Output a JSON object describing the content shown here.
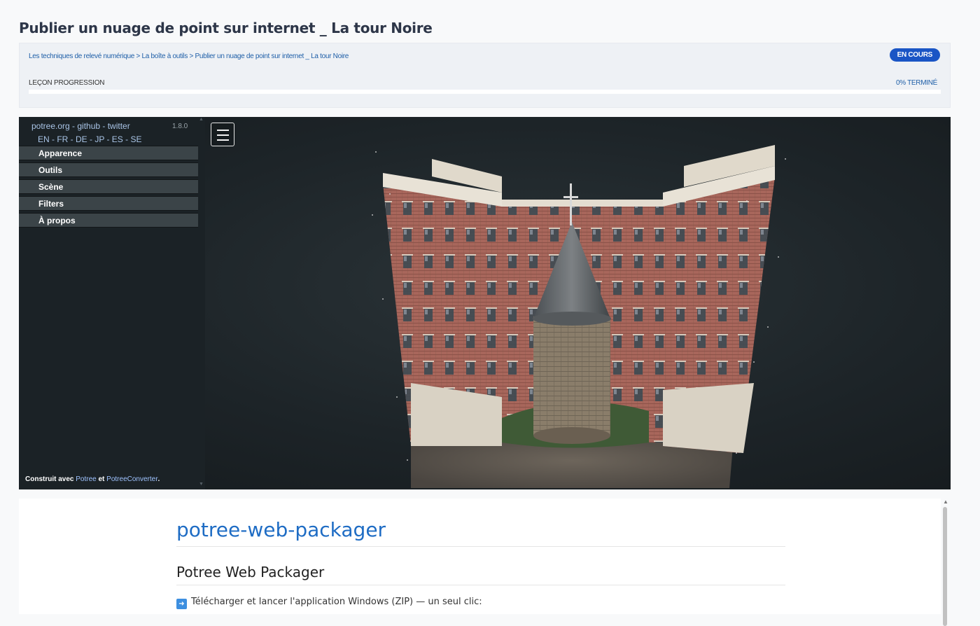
{
  "page": {
    "title": "Publier un nuage de point sur internet _ La tour Noire"
  },
  "lesson": {
    "breadcrumb": [
      "Les techniques de relevé numérique",
      "La boîte à outils",
      "Publier un nuage de point sur internet _ La tour Noire"
    ],
    "breadcrumb_separator": " > ",
    "status": "EN COURS",
    "progress_label": "LEÇON PROGRESSION",
    "progress_text": "0% TERMINÉ",
    "progress_fraction": 0
  },
  "viewer": {
    "links": "potree.org - github - twitter",
    "version": "1.8.0",
    "languages": "EN - FR - DE - JP - ES - SE",
    "menu": [
      "Apparence",
      "Outils",
      "Scène",
      "Filters",
      "À propos"
    ],
    "footer_prefix": "Construit avec ",
    "footer_link1": "Potree",
    "footer_mid": " et ",
    "footer_link2": "PotreeConverter",
    "footer_suffix": ".",
    "menu_icon": "hamburger-icon",
    "colors": {
      "sidebar": "#1b2226",
      "accordion": "#3b4448",
      "link": "#a9c4e6"
    }
  },
  "doc": {
    "h1": "potree-web-packager",
    "h2": "Potree Web Packager",
    "para_icon": "right-arrow-icon",
    "para": "Télécharger et lancer l'application Windows (ZIP) — un seul clic:"
  },
  "colors": {
    "accent": "#1a55c5",
    "heading": "#2d3648",
    "link": "#1e6cc4"
  }
}
